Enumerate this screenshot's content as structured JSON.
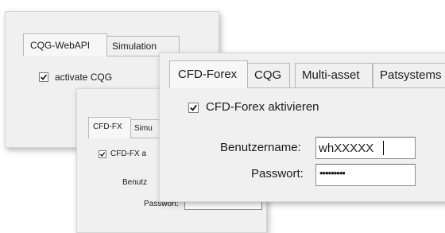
{
  "panel_back": {
    "tabs": [
      "CQG-WebAPI",
      "Simulation"
    ],
    "checkbox_label": "activate CQG",
    "checkbox_checked": true
  },
  "panel_mid": {
    "tabs": [
      "CFD-FX",
      "Simu"
    ],
    "checkbox_label": "CFD-FX a",
    "checkbox_checked": true,
    "username_label": "Benutz",
    "password_label": "Passwort:",
    "password_value": "•••••••••"
  },
  "panel_front": {
    "tabs": [
      "CFD-Forex",
      "CQG",
      "Multi-asset",
      "Patsystems"
    ],
    "checkbox_label": "CFD-Forex aktivieren",
    "checkbox_checked": true,
    "username_label": "Benutzername:",
    "username_value": "whXXXXX",
    "password_label": "Passwort:",
    "password_value": "•••••••••"
  }
}
